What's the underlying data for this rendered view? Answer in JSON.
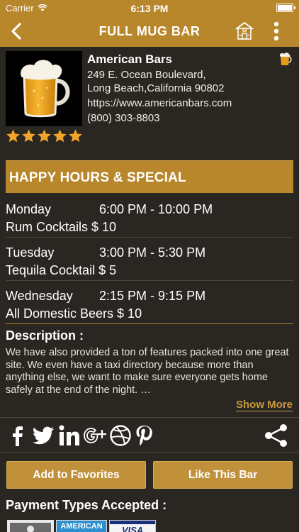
{
  "status": {
    "carrier": "Carrier",
    "time": "6:13 PM"
  },
  "nav": {
    "title": "FULL MUG BAR"
  },
  "bar": {
    "category": "American Bars",
    "address_line1": "249 E. Ocean Boulevard,",
    "address_line2": "Long Beach,California 90802",
    "website": "https://www.americanbars.com",
    "phone": "(800) 303-8803",
    "rating": 5
  },
  "happy_hours": {
    "title": "HAPPY HOURS & SPECIAL",
    "rows": [
      {
        "day": "Monday",
        "hours": "6:00 PM - 10:00 PM",
        "special": "Rum Cocktails $ 10"
      },
      {
        "day": "Tuesday",
        "hours": "3:00 PM - 5:30 PM",
        "special": "Tequila Cocktail $ 5"
      },
      {
        "day": "Wednesday",
        "hours": "2:15 PM - 9:15 PM",
        "special": "All Domestic Beers $ 10"
      }
    ]
  },
  "description": {
    "title": "Description :",
    "text": "We have also provided a ton of features packed into one great site.  We even have a taxi directory because more than anything else, we want to make sure everyone gets home safely at the end of the night. …",
    "show_more": "Show More"
  },
  "actions": {
    "favorites": "Add to Favorites",
    "like": "Like This Bar"
  },
  "payment": {
    "title": "Payment Types Accepted :",
    "amex_text": "AMERICAN",
    "visa_text": "VISA"
  },
  "colors": {
    "gold": "#b8862b",
    "background": "#2a2723",
    "star": "#f2a32a"
  },
  "icons": [
    "back-chevron-icon",
    "home-icon",
    "more-vertical-icon",
    "beer-mug-icon",
    "star-icon",
    "facebook-icon",
    "twitter-icon",
    "linkedin-icon",
    "google-plus-icon",
    "dribbble-icon",
    "pinterest-icon",
    "share-icon"
  ]
}
